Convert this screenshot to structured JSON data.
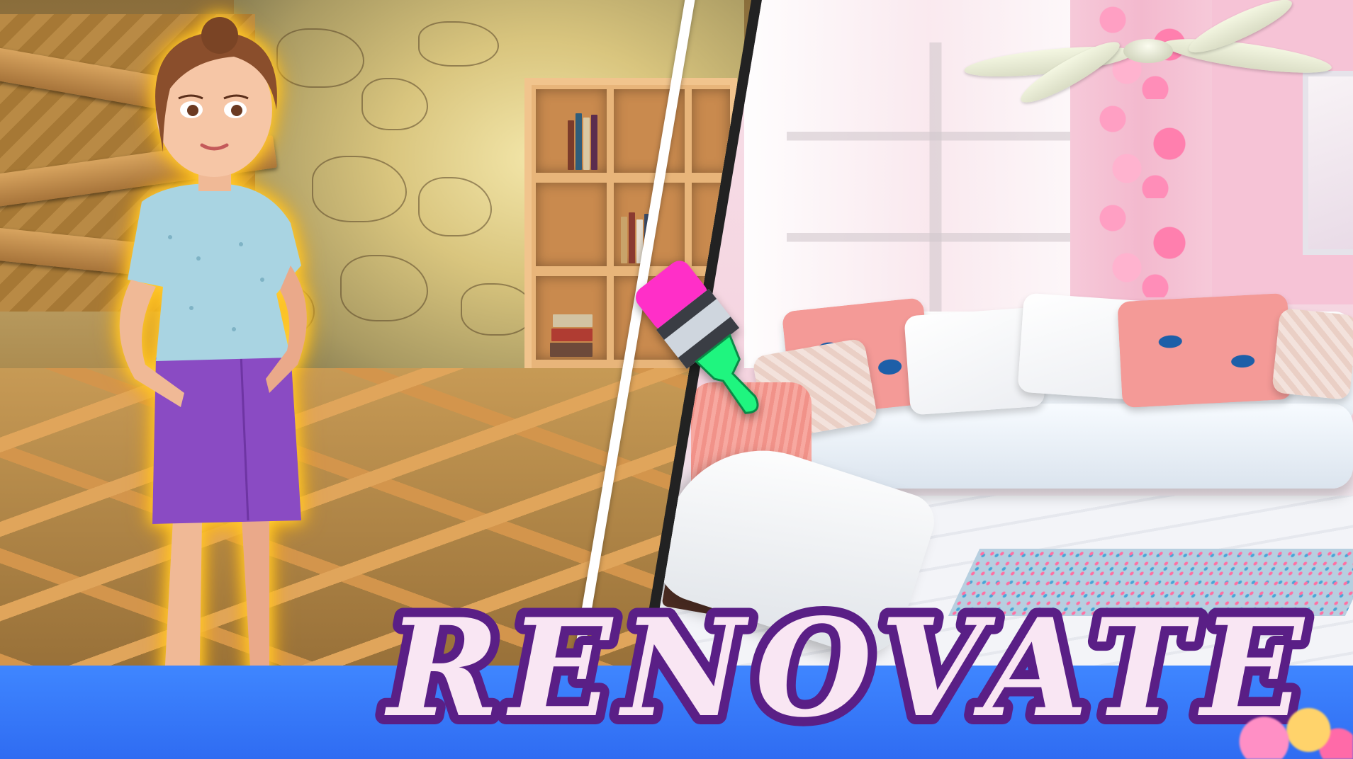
{
  "scene": {
    "title": "RENOVATE",
    "left_panel_state": "before",
    "right_panel_state": "after"
  },
  "icons": {
    "paint_brush": "paint-brush-icon",
    "character": "character-avatar"
  },
  "colors": {
    "title_fill": "#f9e6f3",
    "title_outline": "#5a1f86",
    "banner_blue": "#2f6cf2",
    "brush_handle": "#1ff57f",
    "brush_tip": "#ff2fc8",
    "character_glow": "#ffc61a"
  }
}
